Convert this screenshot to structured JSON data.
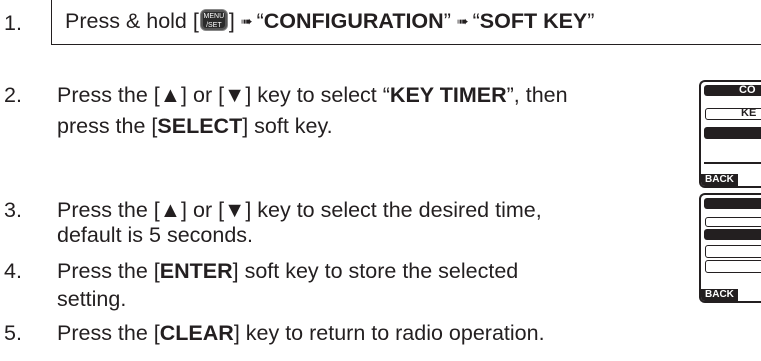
{
  "steps": [
    {
      "number": "1.",
      "pre": "Press & hold [",
      "key_label": [
        "MENU",
        "/SET"
      ],
      "post": "]",
      "q1_open": "“",
      "q1_bold": "CONFIGURATION",
      "q1_close": "”",
      "q2_open": "“",
      "q2_bold": "SOFT KEY",
      "q2_close": "”"
    },
    {
      "number": "2.",
      "line1_pre": "Press the [▲] or [▼] key to select “",
      "line1_bold": "KEY TIMER",
      "line1_post": "”, then",
      "line2_pre": "press the [",
      "line2_bold": "SELECT",
      "line2_post": "] soft key."
    },
    {
      "number": "3.",
      "line1": "Press the [▲] or [▼] key to select the desired time,",
      "line2": "default is 5 seconds."
    },
    {
      "number": "4.",
      "line1_pre": "Press the [",
      "line1_bold": "ENTER",
      "line1_post": "] soft key to store the selected",
      "line2": "setting."
    },
    {
      "number": "5.",
      "pre": "Press the [",
      "bold": "CLEAR",
      "post": "] key to return to radio operation."
    }
  ],
  "screens": [
    {
      "header_fragment": "CO",
      "item_fragment": "KE",
      "back_label": "BACK"
    },
    {
      "back_label": "BACK"
    }
  ],
  "arrow_glyph": "➠"
}
